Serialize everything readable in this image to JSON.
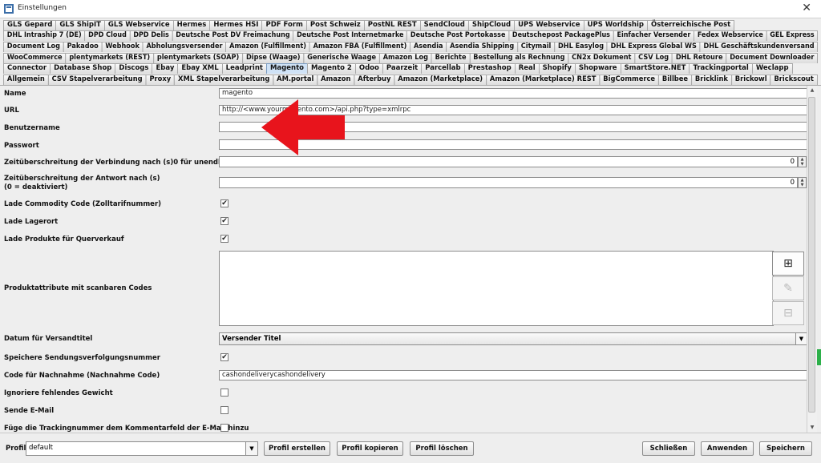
{
  "window": {
    "title": "Einstellungen"
  },
  "tab_rows": [
    [
      "GLS Gepard",
      "GLS ShipIT",
      "GLS Webservice",
      "Hermes",
      "Hermes HSI",
      "PDF Form",
      "Post Schweiz",
      "PostNL REST",
      "SendCloud",
      "ShipCloud",
      "UPS Webservice",
      "UPS Worldship",
      "Österreichische Post"
    ],
    [
      "DHL Intraship 7 (DE)",
      "DPD Cloud",
      "DPD Delis",
      "Deutsche Post DV Freimachung",
      "Deutsche Post Internetmarke",
      "Deutsche Post Portokasse",
      "Deutschepost PackagePlus",
      "Einfacher Versender",
      "Fedex Webservice",
      "GEL Express"
    ],
    [
      "Document Log",
      "Pakadoo",
      "Webhook",
      "Abholungsversender",
      "Amazon (Fulfillment)",
      "Amazon FBA (Fulfillment)",
      "Asendia",
      "Asendia Shipping",
      "Citymail",
      "DHL Easylog",
      "DHL Express Global WS",
      "DHL Geschäftskundenversand"
    ],
    [
      "WooCommerce",
      "plentymarkets (REST)",
      "plentymarkets (SOAP)",
      "Dipse (Waage)",
      "Generische Waage",
      "Amazon Log",
      "Berichte",
      "Bestellung als Rechnung",
      "CN2x Dokument",
      "CSV Log",
      "DHL Retoure",
      "Document Downloader"
    ],
    [
      "Connector",
      "Database Shop",
      "Discogs",
      "Ebay",
      "Ebay XML",
      "Leadprint",
      "Magento",
      "Magento 2",
      "Odoo",
      "Paarzeit",
      "Parcellab",
      "Prestashop",
      "Real",
      "Shopify",
      "Shopware",
      "SmartStore.NET",
      "Trackingportal",
      "Weclapp"
    ],
    [
      "Allgemein",
      "CSV Stapelverarbeitung",
      "Proxy",
      "XML Stapelverarbeitung",
      "AM.portal",
      "Amazon",
      "Afterbuy",
      "Amazon (Marketplace)",
      "Amazon (Marketplace) REST",
      "BigCommerce",
      "Billbee",
      "Bricklink",
      "Brickowl",
      "Brickscout"
    ]
  ],
  "active_tab": "Magento",
  "form": {
    "name_label": "Name",
    "name_value": "magento",
    "url_label": "URL",
    "url_value": "http://<www.yourmagento.com>/api.php?type=xmlrpc",
    "user_label": "Benutzername",
    "user_value": "",
    "pass_label": "Passwort",
    "pass_value": "",
    "conn_timeout_label": "Zeitüberschreitung der Verbindung nach (s)0 für unendlich",
    "conn_timeout_value": "0",
    "resp_timeout_label_1": "Zeitüberschreitung der Antwort nach (s)",
    "resp_timeout_label_2": "(0 = deaktiviert)",
    "resp_timeout_value": "0",
    "commodity_label": "Lade Commodity Code (Zolltarifnummer)",
    "commodity_checked": true,
    "lagerort_label": "Lade Lagerort",
    "lagerort_checked": true,
    "querverkauf_label": "Lade Produkte für Querverkauf",
    "querverkauf_checked": true,
    "attr_label": "Produktattribute mit scanbaren Codes",
    "versandtitel_label": "Datum für Versandtitel",
    "versandtitel_value": "Versender Titel",
    "tracking_label": "Speichere Sendungsverfolgungsnummer",
    "tracking_checked": true,
    "cod_label": "Code für Nachnahme (Nachnahme Code)",
    "cod_value": "cashondeliverycashondelivery",
    "weight_label": "Ignoriere fehlendes Gewicht",
    "weight_checked": false,
    "email_label": "Sende E-Mail",
    "email_checked": false,
    "comment_label": "Füge die Trackingnummer dem Kommentarfeld der E-Mail hinzu",
    "comment_checked": false
  },
  "bottom": {
    "profile_label": "Profil",
    "profile_value": "default",
    "create": "Profil erstellen",
    "copy": "Profil kopieren",
    "delete": "Profil löschen",
    "close": "Schließen",
    "apply": "Anwenden",
    "save": "Speichern"
  },
  "icons": {
    "add": "plus-icon",
    "edit": "edit-icon",
    "remove": "minus-icon"
  },
  "colors": {
    "arrow": "#e8141c",
    "active_tab": "#cfe2f6"
  }
}
